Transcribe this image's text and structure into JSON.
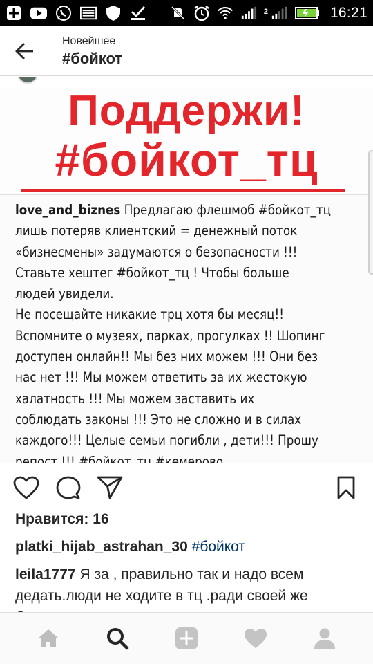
{
  "status_bar": {
    "time": "16:21",
    "sim_label": "2",
    "icons": [
      "add-box-icon",
      "youtube-icon",
      "whatsapp-icon",
      "image-icon",
      "shield-icon",
      "checkmark-icon",
      "mute-icon",
      "alarm-icon",
      "wifi-icon",
      "signal-icon",
      "signal-2-icon",
      "battery-icon"
    ]
  },
  "header": {
    "subtitle": "Новейшее",
    "title": "#бойкот"
  },
  "post": {
    "image": {
      "banner_line1": "Поддержи!",
      "banner_line2": "#бойкот_тц",
      "caption_user": "love_and_biznes",
      "caption_lines": [
        "Предлагаю флешмоб #бойкот_тц",
        "лишь потеряв клиентский = денежный поток",
        "«бизнесмены» задумаются о безопасности !!!",
        "Ставьте хештег #бойкот_тц ! Чтобы больше",
        "людей увидели.",
        "Не посещайте никакие трц хотя бы месяц!!",
        "Вспомните о музеях, парках, прогулках !! Шопинг",
        "доступен онлайн!! Мы без них можем !!! Они без",
        "нас нет !!! Мы можем ответить за их жестокую",
        "халатность !!! Мы можем заставить их",
        "соблюдать законы !!! Это не сложно и в силах",
        "каждого!!! Целые семьи погибли , дети!!! Прошу",
        "репост !!! #бойкот_тц #кемерово"
      ]
    },
    "actions": {
      "like_icon": "heart-icon",
      "comment_icon": "comment-icon",
      "share_icon": "share-icon",
      "save_icon": "bookmark-icon"
    },
    "likes_text": "Нравится: 16",
    "comments": [
      {
        "user": "platki_hijab_astrahan_30",
        "text": "#бойкот"
      },
      {
        "user": "leila1777",
        "text": "Я за , правильно так и надо всем дедать.люди не ходите в тц .ради своей же безопасности"
      }
    ]
  },
  "bottom_nav": {
    "items": [
      "home-icon",
      "search-icon",
      "add-post-icon",
      "activity-heart-icon",
      "profile-icon"
    ],
    "active": "search-icon"
  },
  "colors": {
    "banner_red": "#e3262b",
    "hashtag_blue": "#003569",
    "status_bar_bg": "#000000"
  }
}
